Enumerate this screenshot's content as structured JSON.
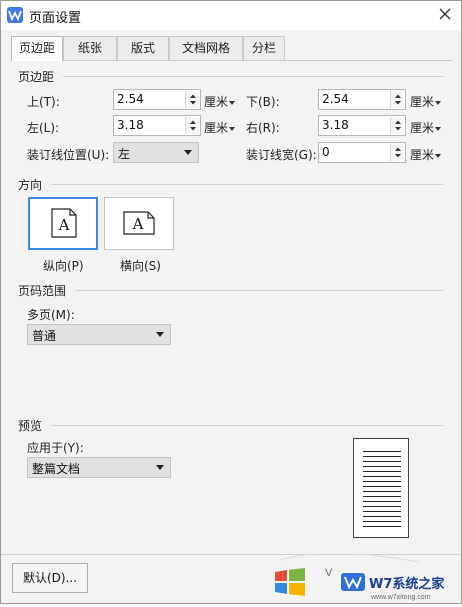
{
  "window": {
    "title": "页面设置"
  },
  "tabs": [
    {
      "label": "页边距",
      "active": true
    },
    {
      "label": "纸张"
    },
    {
      "label": "版式"
    },
    {
      "label": "文档网格"
    },
    {
      "label": "分栏"
    }
  ],
  "margins": {
    "section_title": "页边距",
    "top": {
      "label": "上(T):",
      "value": "2.54",
      "unit": "厘米"
    },
    "bottom": {
      "label": "下(B):",
      "value": "2.54",
      "unit": "厘米"
    },
    "left": {
      "label": "左(L):",
      "value": "3.18",
      "unit": "厘米"
    },
    "right": {
      "label": "右(R):",
      "value": "3.18",
      "unit": "厘米"
    },
    "gutter_position": {
      "label": "装订线位置(U):",
      "value": "左"
    },
    "gutter_width": {
      "label": "装订线宽(G):",
      "value": "0",
      "unit": "厘米"
    }
  },
  "orientation": {
    "section_title": "方向",
    "portrait": {
      "label": "纵向(P)",
      "glyph": "A",
      "selected": true
    },
    "landscape": {
      "label": "横向(S)",
      "glyph": "A"
    }
  },
  "pages": {
    "section_title": "页码范围",
    "multiple_label": "多页(M):",
    "multiple_value": "普通"
  },
  "preview": {
    "section_title": "预览",
    "apply_label": "应用于(Y):",
    "apply_value": "整篇文档"
  },
  "footer": {
    "default_button": "默认(D)..."
  },
  "watermark": {
    "text": "W7系统之家",
    "url": "www.w7xitong.com"
  },
  "colors": {
    "accent": "#3d7ae6",
    "selected_border": "#3d8be0",
    "watermark_text": "#1a3e8c"
  }
}
